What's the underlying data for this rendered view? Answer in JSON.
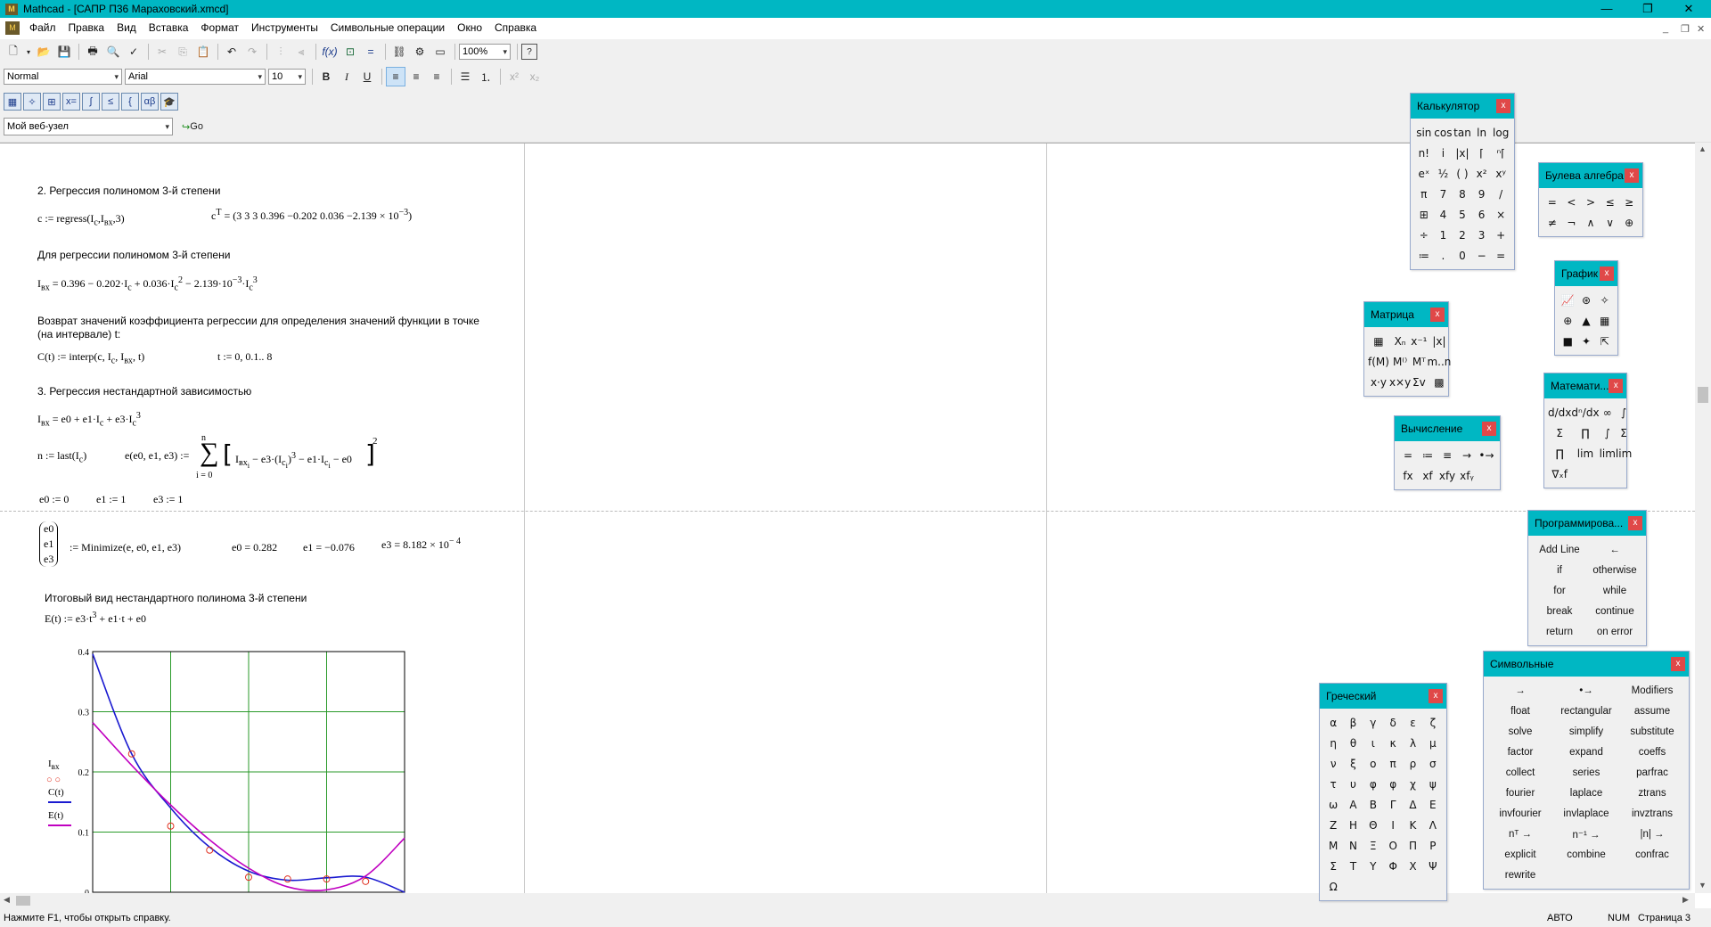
{
  "window": {
    "title": "Mathcad - [САПР П36 Мараховский.xmcd]",
    "app_icon": "mathcad-icon"
  },
  "menu": {
    "items": [
      {
        "label": "Файл"
      },
      {
        "label": "Правка"
      },
      {
        "label": "Вид"
      },
      {
        "label": "Вставка"
      },
      {
        "label": "Формат"
      },
      {
        "label": "Инструменты"
      },
      {
        "label": "Символьные операции"
      },
      {
        "label": "Окно"
      },
      {
        "label": "Справка"
      }
    ]
  },
  "toolbar": {
    "zoom": "100%",
    "style": "Normal",
    "font": "Arial",
    "size": "10",
    "web": "Мой веб-узел",
    "go": "Go"
  },
  "doc": {
    "h2": "2. Регрессия полиномом 3-й степени",
    "regress": "c := regress(I",
    "regress_tail": "c",
    "cT": "c",
    "cT_vals": "= (3  3  3  0.396  −0.202  0.036  −2.139 × 10",
    "cT_exp": "−3",
    "txt_poly": "Для регрессии полиномом 3-й степени",
    "ibx_eq": "= 0.396 − 0.202·I",
    "ibx_eq2": " + 0.036·I",
    "ibx_eq3": " − 2.139·10",
    "ibx_eq4": "·I",
    "txt_interp1": "Возврат значений коэффициента регрессии для определения значений функции в точке",
    "txt_interp2": "(на интервале) t:",
    "interp": "C(t) := interp(c, I",
    "interp_tail": ", t)",
    "trange": "t := 0, 0.1.. 8",
    "h3": "3. Регрессия нестандартной зависимостью",
    "nst": "= e0 + e1·I",
    "nst2": " + e3·I",
    "nlast": "n := last(I",
    "efun": "e(e0, e1, e3) :=",
    "sum_top": "n",
    "sum_bot": "i = 0",
    "sum_body": "− e3·(I",
    "sum_body2": " − e1·I",
    "sum_body3": " − e0",
    "init0": "e0 := 0",
    "init1": "e1 := 1",
    "init3": "e3 := 1",
    "vec0": "e0",
    "vec1": "e1",
    "vec3": "e3",
    "minimize": ":= Minimize(e, e0, e1, e3)",
    "res0": "e0 = 0.282",
    "res1": "e1 = −0.076",
    "res3": "e3 = 8.182 × 10",
    "res3exp": "− 4",
    "final_txt": "Итоговый вид нестандартного полинома 3-й степени",
    "Et": "E(t) := e3·t",
    "Et2": " + e1·t + e0"
  },
  "chart_data": {
    "type": "line",
    "ylim": [
      0,
      0.4
    ],
    "yticks": [
      "0.4",
      "0.3",
      "0.2",
      "0.1",
      "0"
    ],
    "legend": [
      "I",
      "C(t)",
      "E(t)"
    ],
    "series": [
      {
        "name": "I",
        "values_x": [
          1,
          2,
          3,
          4,
          5,
          6,
          7
        ],
        "values": [
          0.23,
          0.11,
          0.07,
          0.025,
          0.022,
          0.022,
          0.018
        ]
      },
      {
        "name": "C(t)",
        "values_x": [
          0,
          1,
          2,
          3,
          4,
          5,
          6,
          7,
          8
        ],
        "values": [
          0.396,
          0.23,
          0.14,
          0.075,
          0.035,
          0.02,
          0.024,
          0.025,
          0
        ]
      },
      {
        "name": "E(t)",
        "values_x": [
          0,
          1,
          2,
          3,
          4,
          5,
          6,
          7,
          8
        ],
        "values": [
          0.282,
          0.211,
          0.145,
          0.087,
          0.04,
          0.009,
          0.004,
          0.027,
          0.09
        ]
      }
    ],
    "colors": {
      "points": "#e03020",
      "C": "#1a1ad0",
      "E": "#c000c0",
      "grid": "#2a9a2a"
    }
  },
  "palettes": {
    "calc": {
      "title": "Калькулятор",
      "cells": [
        "sin",
        "cos",
        "tan",
        "ln",
        "log",
        "n!",
        "i",
        "|x|",
        "⌈",
        "ⁿ⌈",
        "eˣ",
        "½",
        "( )",
        "x²",
        "xʸ",
        "π",
        "7",
        "8",
        "9",
        "/",
        "⊞",
        "4",
        "5",
        "6",
        "×",
        "÷",
        "1",
        "2",
        "3",
        "+",
        "≔",
        ".",
        "0",
        "−",
        "="
      ]
    },
    "bool": {
      "title": "Булева алгебра",
      "cells": [
        "=",
        "<",
        ">",
        "≤",
        "≥",
        "≠",
        "¬",
        "∧",
        "∨",
        "⊕"
      ]
    },
    "graph": {
      "title": "График",
      "cells": [
        "📈",
        "⊛",
        "✧",
        "⊕",
        "▲",
        "▦",
        "■",
        "✦",
        "⇱"
      ]
    },
    "matrix": {
      "title": "Матрица",
      "cells": [
        "▦",
        "Xₙ",
        "x⁻¹",
        "|x|",
        "f(M)",
        "M⁽⁾",
        "Mᵀ",
        "m..n",
        "x·y",
        "x×y",
        "Σv",
        "▩"
      ]
    },
    "eval": {
      "title": "Вычисление",
      "cells": [
        "=",
        "≔",
        "≡",
        "→",
        "•→",
        "fx",
        "xf",
        "xfy",
        "xfᵧ"
      ]
    },
    "mathop": {
      "title": "Математи...",
      "cells": [
        "d/dx",
        "dⁿ/dx",
        "∞",
        "∫",
        "Σ",
        "∏",
        "∫",
        "Σ",
        "∏",
        "lim",
        "lim",
        "lim",
        "∇ₓf"
      ]
    },
    "prog": {
      "title": "Программирова...",
      "cells": [
        "Add Line",
        "←",
        "if",
        "otherwise",
        "for",
        "while",
        "break",
        "continue",
        "return",
        "on error"
      ]
    },
    "greek": {
      "title": "Греческий",
      "cells": [
        "α",
        "β",
        "γ",
        "δ",
        "ε",
        "ζ",
        "η",
        "θ",
        "ι",
        "κ",
        "λ",
        "μ",
        "ν",
        "ξ",
        "ο",
        "π",
        "ρ",
        "σ",
        "τ",
        "υ",
        "φ",
        "φ",
        "χ",
        "ψ",
        "ω",
        "Α",
        "Β",
        "Γ",
        "Δ",
        "Ε",
        "Ζ",
        "Η",
        "Θ",
        "Ι",
        "Κ",
        "Λ",
        "Μ",
        "Ν",
        "Ξ",
        "Ο",
        "Π",
        "Ρ",
        "Σ",
        "Τ",
        "Υ",
        "Φ",
        "Χ",
        "Ψ",
        "Ω"
      ]
    },
    "symb": {
      "title": "Символьные",
      "cells": [
        "→",
        "•→",
        "Modifiers",
        "float",
        "rectangular",
        "assume",
        "solve",
        "simplify",
        "substitute",
        "factor",
        "expand",
        "coeffs",
        "collect",
        "series",
        "parfrac",
        "fourier",
        "laplace",
        "ztrans",
        "invfourier",
        "invlaplace",
        "invztrans",
        "nᵀ →",
        "n⁻¹ →",
        "|n| →",
        "explicit",
        "combine",
        "confrac",
        "rewrite"
      ]
    }
  },
  "status": {
    "help": "Нажмите F1, чтобы открыть справку.",
    "mode": "АВТО",
    "num": "NUM",
    "page": "Страница 3"
  }
}
